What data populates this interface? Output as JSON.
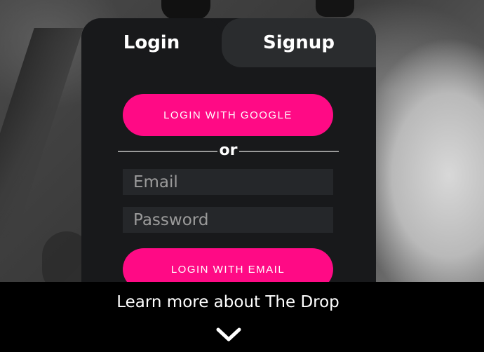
{
  "tabs": {
    "login": "Login",
    "signup": "Signup"
  },
  "auth": {
    "google_button": "LOGIN WITH GOOGLE",
    "divider": "or",
    "email_placeholder": "Email",
    "password_placeholder": "Password",
    "email_button": "LOGIN WITH EMAIL"
  },
  "footer": {
    "learn_more": "Learn more about The Drop",
    "icon": "chevron-down-icon"
  },
  "colors": {
    "accent": "#ff0a85",
    "card": "#18191b",
    "inactive_tab": "#2a2c2e",
    "field": "#25272a"
  }
}
